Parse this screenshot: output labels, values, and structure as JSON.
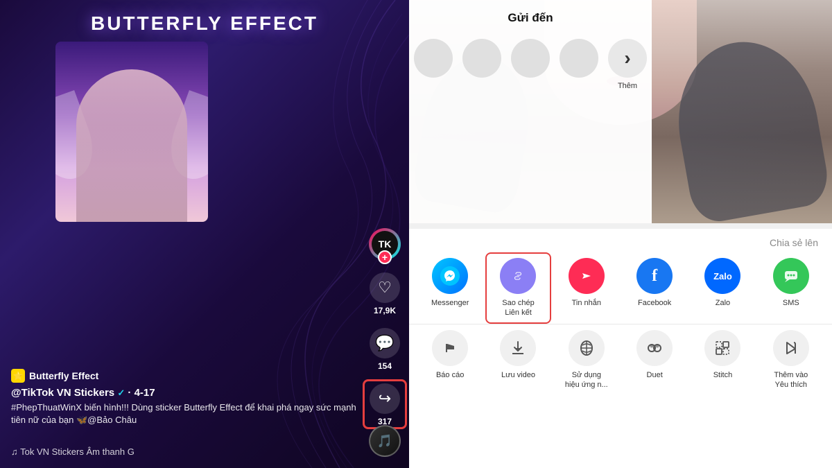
{
  "video": {
    "title": "BUTTERFLY EFFECT",
    "username": "@TikTok VN Stickers",
    "verified": true,
    "date": "4-17",
    "description": "#PhepThuatWinX biến hình!!! Dùng sticker Butterfly Effect để khai phá ngay sức mạnh tiên nữ của bạn 🦋@Bảo Châu",
    "music": "♫  Tok VN Stickers Âm thanh G",
    "song_name": "Butterfly Effect",
    "likes": "17,9K",
    "comments": "154",
    "shares": "317"
  },
  "share_panel": {
    "title": "Gửi đến",
    "chia_se_label": "Chia sẻ lên",
    "more_label": "Thêm",
    "apps": [
      {
        "id": "messenger",
        "label": "Messenger",
        "icon": "💬",
        "class": "app-icon-messenger"
      },
      {
        "id": "copy-link",
        "label": "Sao chép\nLiên kết",
        "icon": "🔗",
        "class": "app-icon-copy"
      },
      {
        "id": "tin-nhan",
        "label": "Tin nhắn",
        "icon": "▷",
        "class": "app-icon-tin-nhan"
      },
      {
        "id": "facebook",
        "label": "Facebook",
        "icon": "f",
        "class": "app-icon-facebook"
      },
      {
        "id": "zalo",
        "label": "Zalo",
        "icon": "Zalo",
        "class": "app-icon-zalo"
      },
      {
        "id": "sms",
        "label": "SMS",
        "icon": "💬",
        "class": "app-icon-sms"
      }
    ],
    "actions": [
      {
        "id": "bao-cao",
        "label": "Báo cáo",
        "icon": "⚑"
      },
      {
        "id": "luu-video",
        "label": "Lưu video",
        "icon": "⬇"
      },
      {
        "id": "su-dung",
        "label": "Sử dụng\nhiệu ứng n...",
        "icon": "🎭"
      },
      {
        "id": "duet",
        "label": "Duet",
        "icon": "☺"
      },
      {
        "id": "stitch",
        "label": "Stitch",
        "icon": "⊡"
      },
      {
        "id": "them-vao",
        "label": "Thêm vào\nYêu thích",
        "icon": "🔖"
      }
    ]
  },
  "icons": {
    "heart": "♡",
    "comment": "...",
    "share": "↪",
    "music_note": "♫",
    "tiktok_logo": "TikTok",
    "chevron_right": "›"
  }
}
